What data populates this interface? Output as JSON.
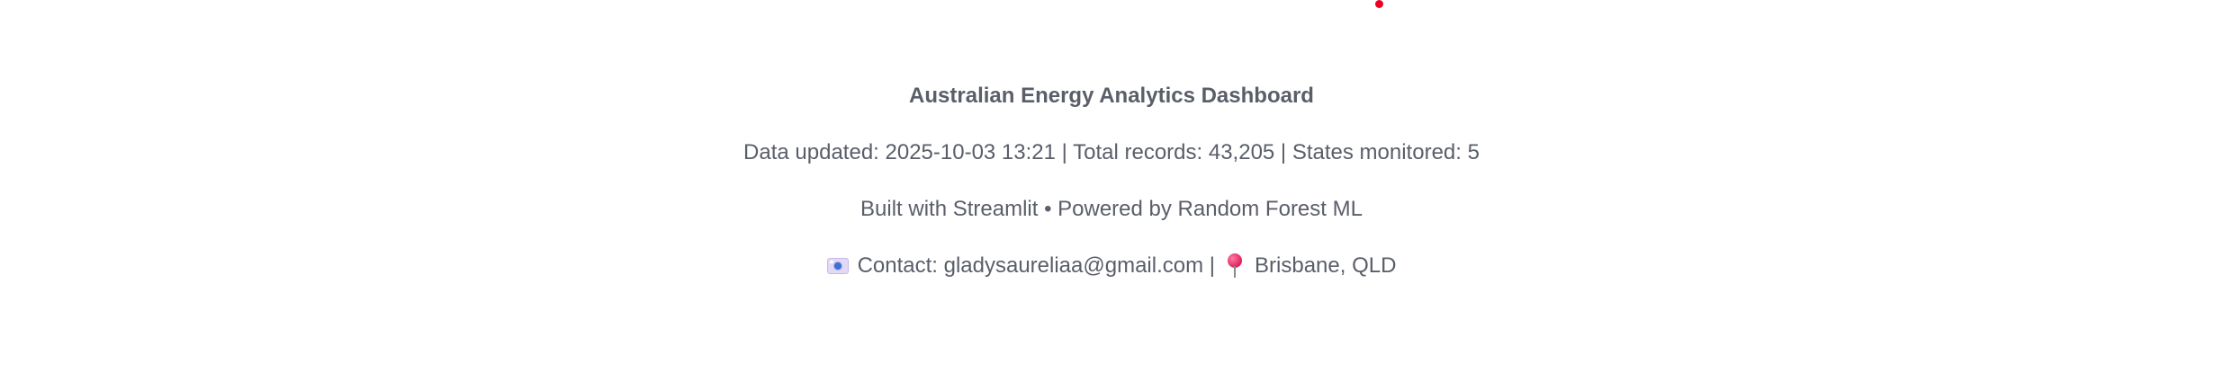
{
  "footer": {
    "title": "Australian Energy Analytics Dashboard",
    "meta": "Data updated: 2025-10-03 13:21 | Total records: 43,205 | States monitored: 5",
    "built_with": "Built with Streamlit • Powered by Random Forest ML",
    "contact": {
      "email_icon": "camera-icon",
      "email_text": "Contact: gladysaureliaa@gmail.com |",
      "location_icon": "round-pushpin-icon",
      "location_text": "Brisbane, QLD"
    }
  },
  "colors": {
    "text": "#5a5e69",
    "status_dot": "#ee0022"
  }
}
